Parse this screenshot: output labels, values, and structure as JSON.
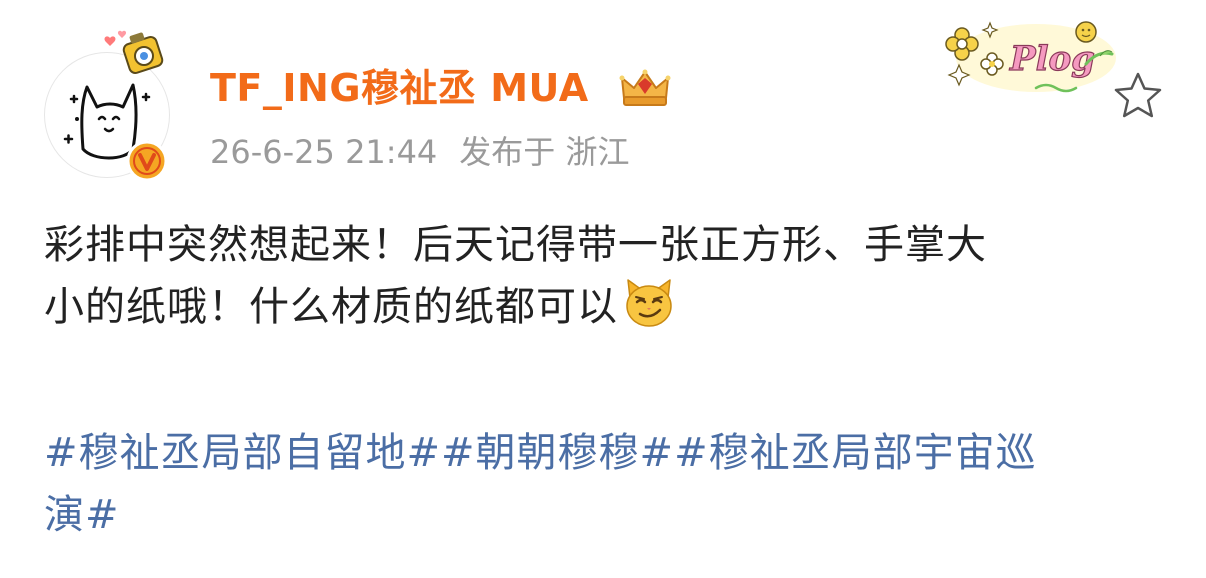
{
  "post": {
    "username": "TF_ING穆祉丞 MUA",
    "time": "26-6-25 21:44",
    "location": "发布于 浙江",
    "text_line1": "彩排中突然想起来！后天记得带一张正方形、手掌大",
    "text_line2": "小的纸哦！什么材质的纸都可以",
    "hashtag1": "#穆祉丞局部自留地#",
    "hashtag2": "#朝朝穆穆#",
    "hashtag3_part1": "#穆祉丞局部宇宙巡",
    "hashtag3_part2": "演#"
  },
  "sticker": {
    "text": "Plog"
  },
  "icons": {
    "avatar": "cartoon-cat-avatar",
    "verified": "orange-v-verified-badge",
    "crown": "membership-crown-badge",
    "star": "star-outline-icon",
    "emoji": "smirking-cat-emoji",
    "pendant": "camera-pendant-decoration"
  },
  "colors": {
    "username": "#f26b19",
    "meta": "#9a9a9a",
    "text": "#222222",
    "hashtag": "#4b6ea5",
    "verified": "#f5a623"
  }
}
